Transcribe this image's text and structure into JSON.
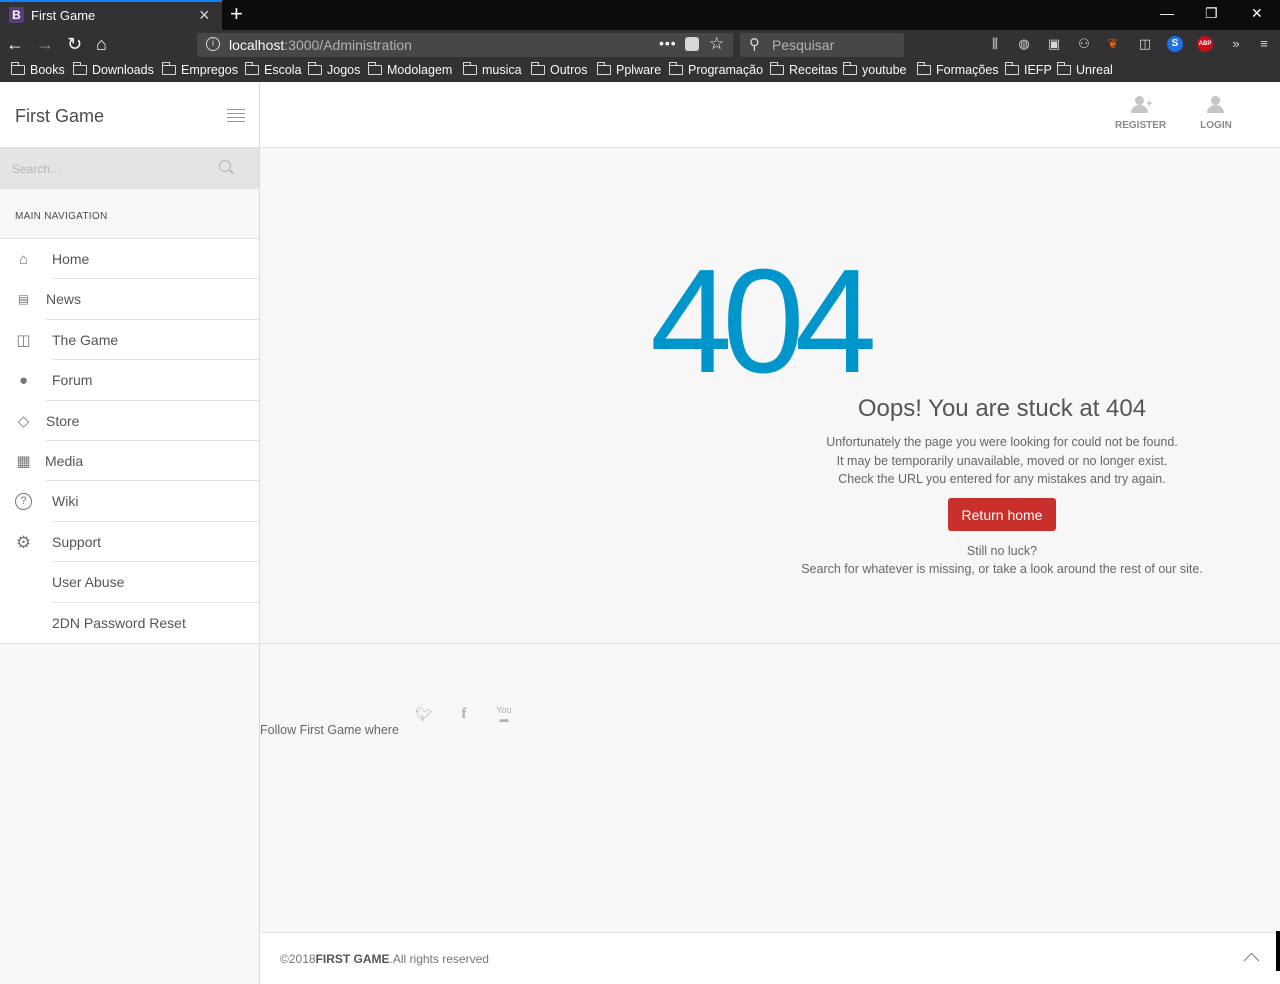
{
  "browser": {
    "tab_title": "First Game",
    "tab_favicon": "B",
    "url_host": "localhost",
    "url_path": ":3000/Administration",
    "search_placeholder": "Pesquisar",
    "bookmarks": [
      "Books",
      "Downloads",
      "Empregos",
      "Escola",
      "Jogos",
      "Modolagem",
      "musica",
      "Outros",
      "Pplware",
      "Programação",
      "Receitas",
      "youtube",
      "Formações",
      "IEFP",
      "Unreal"
    ],
    "accent": "#0a84ff"
  },
  "sidebar": {
    "brand": "First Game",
    "search_placeholder": "Search...",
    "heading": "MAIN NAVIGATION",
    "items": [
      {
        "label": "Home",
        "icon": "home-icon"
      },
      {
        "label": "News",
        "icon": "newspaper-icon"
      },
      {
        "label": "The Game",
        "icon": "book-icon"
      },
      {
        "label": "Forum",
        "icon": "chat-bubble-icon"
      },
      {
        "label": "Store",
        "icon": "diamond-icon"
      },
      {
        "label": "Media",
        "icon": "film-icon"
      },
      {
        "label": "Wiki",
        "icon": "question-circle-icon"
      },
      {
        "label": "Support",
        "icon": "gear-icon"
      },
      {
        "label": "User Abuse",
        "icon": ""
      },
      {
        "label": "2DN Password Reset",
        "icon": ""
      }
    ]
  },
  "header": {
    "register": "REGISTER",
    "login": "LOGIN"
  },
  "error": {
    "code": "404",
    "title": "Oops! You are stuck at 404",
    "line1": "Unfortunately the page you were looking for could not be found.",
    "line2": "It may be temporarily unavailable, moved or no longer exist.",
    "line3": "Check the URL you entered for any mistakes and try again.",
    "button": "Return home",
    "still": "Still no luck?",
    "hint": "Search for whatever is missing, or take a look around the rest of our site.",
    "code_color": "#0096cc",
    "button_color": "#c9302c"
  },
  "social": {
    "follow": "Follow First Game where",
    "icons": [
      "twitter-icon",
      "facebook-icon",
      "youtube-icon"
    ]
  },
  "footer": {
    "prefix": "©2018",
    "brand": "FIRST GAME",
    "suffix": ".All rights reserved"
  }
}
